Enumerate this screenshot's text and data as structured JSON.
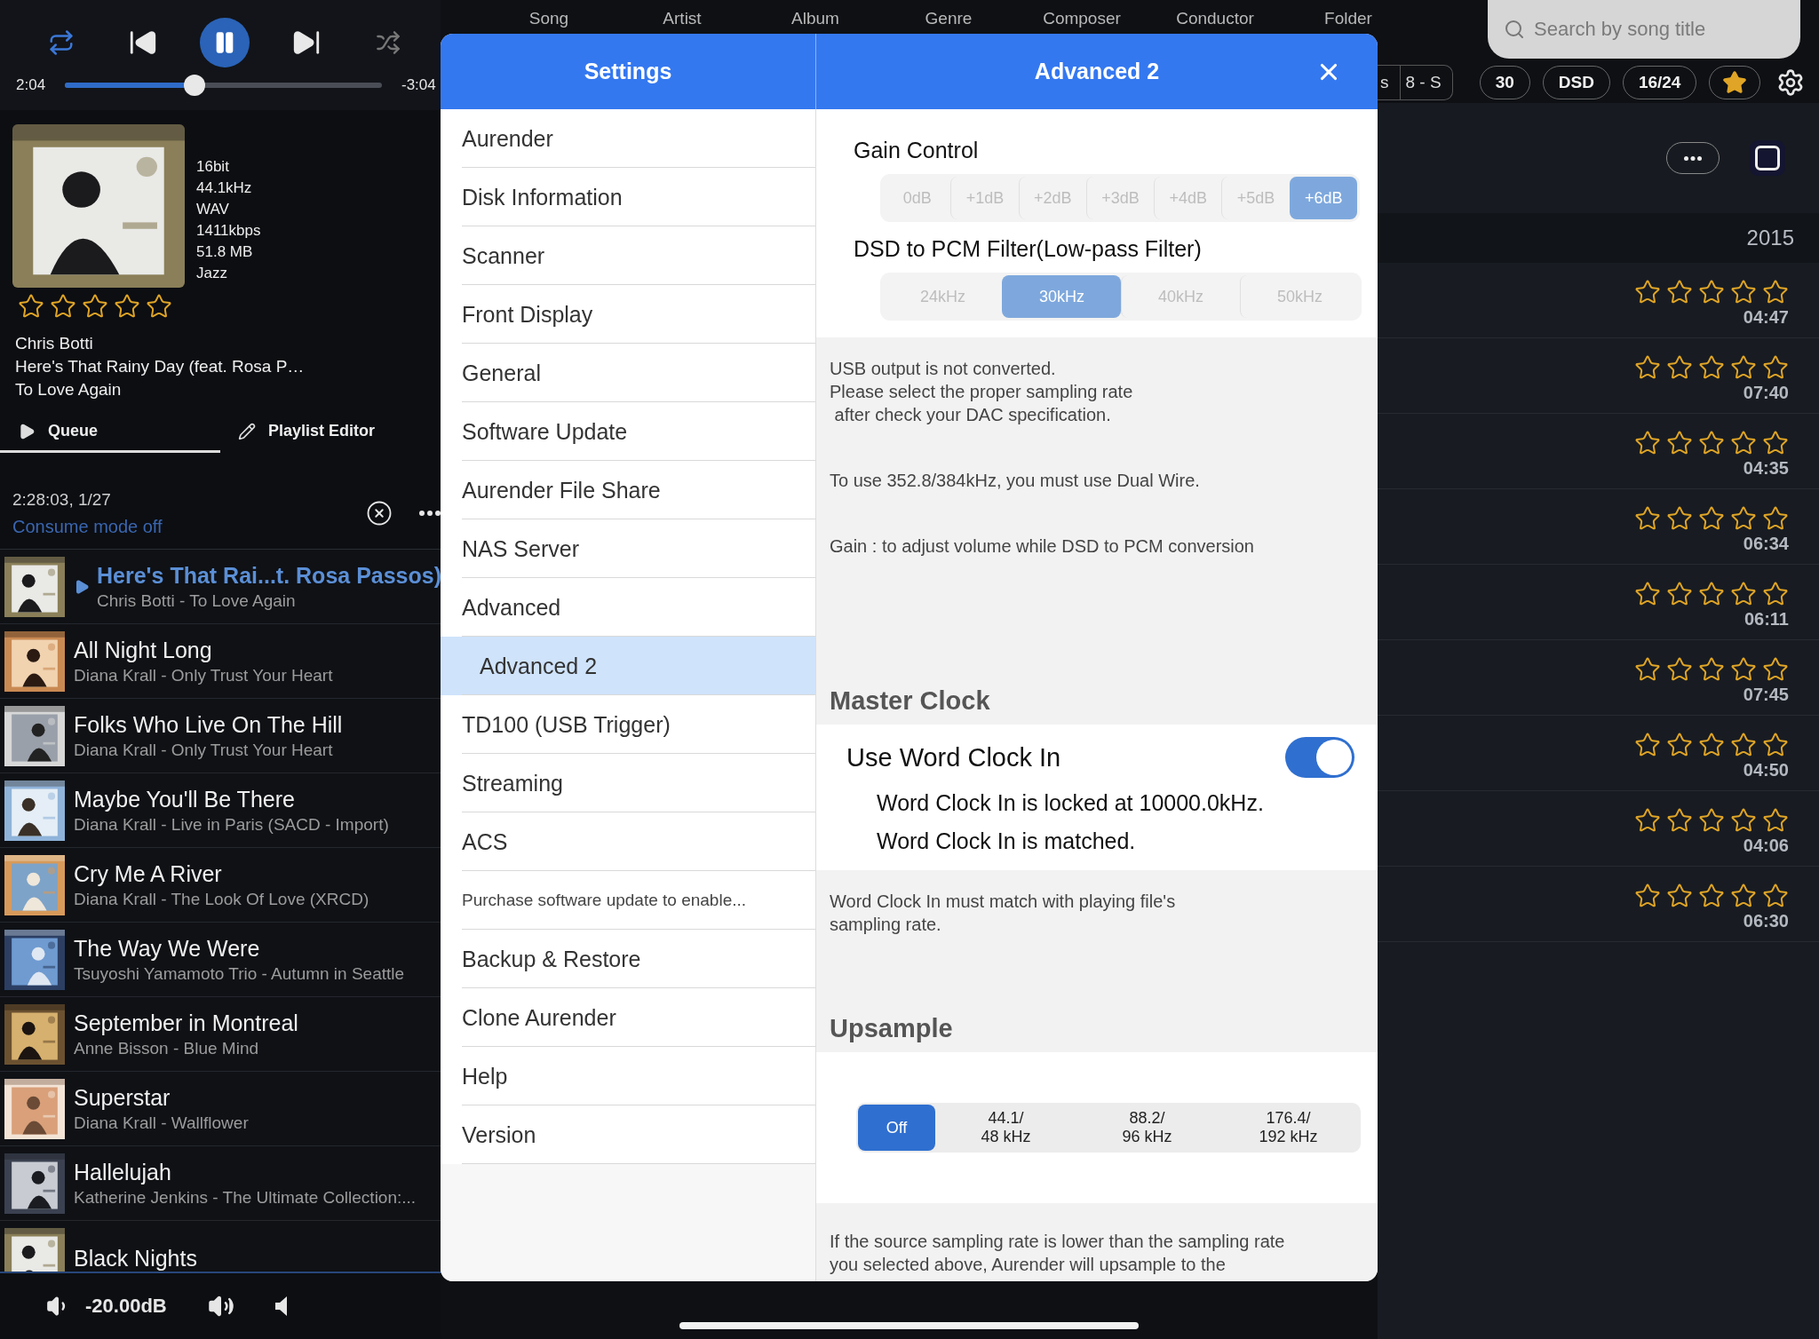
{
  "player": {
    "repeat": true,
    "shuffle": false,
    "elapsed": "2:04",
    "remaining": "-3:04",
    "progress": {
      "level": 0.41
    }
  },
  "now_playing": {
    "format": [
      "16bit",
      "44.1kHz",
      "WAV",
      "1411kbps",
      "51.8 MB",
      "Jazz"
    ],
    "stars": 0,
    "artist": "Chris Botti",
    "title": "Here's That Rainy Day (feat. Rosa P…",
    "album": "To Love Again"
  },
  "queue_tabs": [
    {
      "label": "Queue",
      "kind": "play",
      "selected": true
    },
    {
      "label": "Playlist Editor",
      "kind": "edit",
      "selected": false
    }
  ],
  "queue": {
    "summary": "2:28:03, 1/27",
    "consume": "Consume mode off",
    "tracks": [
      {
        "title": "Here's That Rai...t. Rosa Passos)",
        "subtitle": "Chris Botti - To Love Again",
        "playing": true
      },
      {
        "title": "All Night Long",
        "subtitle": "Diana Krall - Only Trust Your Heart",
        "playing": false
      },
      {
        "title": "Folks Who Live On The Hill",
        "subtitle": "Diana Krall - Only Trust Your Heart",
        "playing": false
      },
      {
        "title": "Maybe You'll Be There",
        "subtitle": "Diana Krall - Live in Paris (SACD - Import)",
        "playing": false
      },
      {
        "title": "Cry Me A River",
        "subtitle": "Diana Krall - The Look Of Love (XRCD)",
        "playing": false
      },
      {
        "title": "The Way We Were",
        "subtitle": "Tsuyoshi Yamamoto Trio - Autumn in Seattle",
        "playing": false
      },
      {
        "title": "September in Montreal",
        "subtitle": "Anne Bisson - Blue Mind",
        "playing": false
      },
      {
        "title": "Superstar",
        "subtitle": "Diana Krall - Wallflower",
        "playing": false
      },
      {
        "title": "Hallelujah",
        "subtitle": "Katherine Jenkins - The Ultimate Collection:...",
        "playing": false
      },
      {
        "title": "Black Nights",
        "playing": false
      }
    ]
  },
  "volume": {
    "reading": "-20.00dB"
  },
  "library_tabs": [
    "Song",
    "Artist",
    "Album",
    "Genre",
    "Composer",
    "Conductor",
    "Folder"
  ],
  "search": {
    "placeholder": "Search by song title"
  },
  "segment_peek": [
    "s",
    "8 - S"
  ],
  "filters": [
    "30",
    "DSD",
    "16/24"
  ],
  "year": "2015",
  "songs": [
    {
      "stars": 0,
      "duration": "04:47"
    },
    {
      "stars": 0,
      "duration": "07:40"
    },
    {
      "stars": 0,
      "duration": "04:35"
    },
    {
      "stars": 0,
      "duration": "06:34"
    },
    {
      "stars": 0,
      "duration": "06:11"
    },
    {
      "stars": 0,
      "duration": "07:45"
    },
    {
      "stars": 0,
      "duration": "04:50"
    },
    {
      "stars": 0,
      "duration": "04:06"
    },
    {
      "stars": 0,
      "duration": "06:30"
    }
  ],
  "settings": {
    "title": "Settings",
    "items": [
      {
        "label": "Aurender",
        "kind": "item",
        "selected": false
      },
      {
        "label": "Disk Information",
        "kind": "item",
        "selected": false
      },
      {
        "label": "Scanner",
        "kind": "item",
        "selected": false
      },
      {
        "label": "Front Display",
        "kind": "item",
        "selected": false
      },
      {
        "label": "General",
        "kind": "item",
        "selected": false
      },
      {
        "label": "Software Update",
        "kind": "item",
        "selected": false
      },
      {
        "label": "Aurender File Share",
        "kind": "item",
        "selected": false
      },
      {
        "label": "NAS Server",
        "kind": "item",
        "selected": false
      },
      {
        "label": "Advanced",
        "kind": "item",
        "selected": false
      },
      {
        "label": "Advanced 2",
        "kind": "item",
        "selected": true
      },
      {
        "label": "TD100 (USB Trigger)",
        "kind": "item",
        "selected": false
      },
      {
        "label": "Streaming",
        "kind": "item",
        "selected": false
      },
      {
        "label": "ACS",
        "kind": "item",
        "selected": false
      },
      {
        "label": "Purchase software update to enable...",
        "kind": "note",
        "selected": false
      },
      {
        "label": "Backup & Restore",
        "kind": "item",
        "selected": false
      },
      {
        "label": "Clone Aurender",
        "kind": "item",
        "selected": false
      },
      {
        "label": "Help",
        "kind": "item",
        "selected": false
      },
      {
        "label": "Version",
        "kind": "item",
        "selected": false
      }
    ]
  },
  "detail": {
    "title": "Advanced 2",
    "gain": {
      "label": "Gain Control",
      "options": [
        {
          "label": "0dB",
          "selected": false
        },
        {
          "label": "+1dB",
          "selected": false
        },
        {
          "label": "+2dB",
          "selected": false
        },
        {
          "label": "+3dB",
          "selected": false
        },
        {
          "label": "+4dB",
          "selected": false
        },
        {
          "label": "+5dB",
          "selected": false
        },
        {
          "label": "+6dB",
          "selected": true
        }
      ]
    },
    "filter": {
      "label": "DSD to PCM Filter(Low-pass Filter)",
      "options": [
        {
          "label": "24kHz",
          "selected": false
        },
        {
          "label": "30kHz",
          "selected": true
        },
        {
          "label": "40kHz",
          "selected": false
        },
        {
          "label": "50kHz",
          "selected": false
        }
      ]
    },
    "notes": [
      [
        "USB output is not converted.",
        "Please select the proper sampling rate",
        " after check your DAC specification."
      ],
      [
        "To use 352.8/384kHz, you must use Dual Wire."
      ],
      [
        "Gain : to adjust volume while DSD to PCM conversion"
      ]
    ],
    "master_clock": {
      "heading": "Master Clock",
      "toggle": {
        "label": "Use Word Clock In",
        "on": true
      },
      "status": [
        "Word Clock In is locked at 10000.0kHz.",
        "Word Clock In is matched."
      ],
      "note": [
        "Word Clock In must match with playing file's",
        "sampling rate."
      ]
    },
    "upsample": {
      "heading": "Upsample",
      "options": [
        {
          "lines": [
            "Off"
          ],
          "selected": true
        },
        {
          "lines": [
            "44.1/",
            "48 kHz"
          ],
          "selected": false
        },
        {
          "lines": [
            "88.2/",
            "96 kHz"
          ],
          "selected": false
        },
        {
          "lines": [
            "176.4/",
            "192 kHz"
          ],
          "selected": false
        }
      ],
      "note": [
        "If the source sampling rate is lower than the sampling rate",
        "you selected above, Aurender will upsample to the"
      ]
    }
  }
}
